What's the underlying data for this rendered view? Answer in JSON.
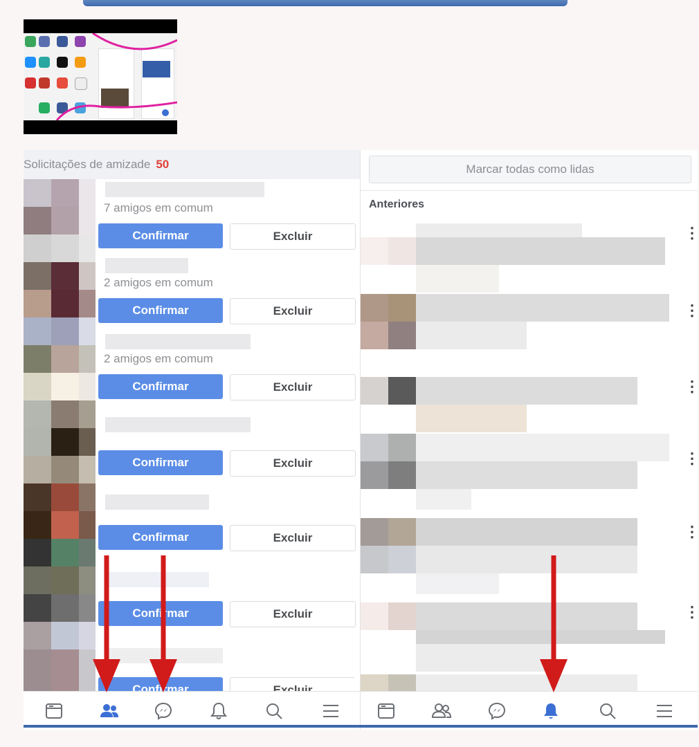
{
  "friend_requests": {
    "title": "Solicitações de amizade",
    "count": "50",
    "items": [
      {
        "mutual": "7 amigos em comum",
        "confirm": "Confirmar",
        "delete": "Excluir"
      },
      {
        "mutual": "2 amigos em comum",
        "confirm": "Confirmar",
        "delete": "Excluir"
      },
      {
        "mutual": "2 amigos em comum",
        "confirm": "Confirmar",
        "delete": "Excluir"
      },
      {
        "mutual": "",
        "confirm": "Confirmar",
        "delete": "Excluir"
      },
      {
        "mutual": "",
        "confirm": "Confirmar",
        "delete": "Excluir"
      },
      {
        "mutual": "",
        "confirm": "Confirmar",
        "delete": "Excluir"
      },
      {
        "mutual": "",
        "confirm": "Confirmar",
        "delete": "Excluir"
      }
    ]
  },
  "notifications": {
    "mark_all_read": "Marcar todas como lidas",
    "section_label": "Anteriores",
    "menu_glyph": "⋮"
  },
  "nav": {
    "left": [
      "feed-icon",
      "friends-icon",
      "messenger-icon",
      "bell-icon",
      "search-icon",
      "menu-icon"
    ],
    "right": [
      "feed-icon",
      "friends-icon",
      "messenger-icon",
      "bell-icon",
      "search-icon",
      "menu-icon"
    ],
    "active_left": "friends-icon",
    "active_right": "bell-icon"
  },
  "colors": {
    "accent": "#5b8de6",
    "nav_active": "#3b6fd4",
    "count_red": "#e0413b",
    "arrow_red": "#d11a1a"
  }
}
